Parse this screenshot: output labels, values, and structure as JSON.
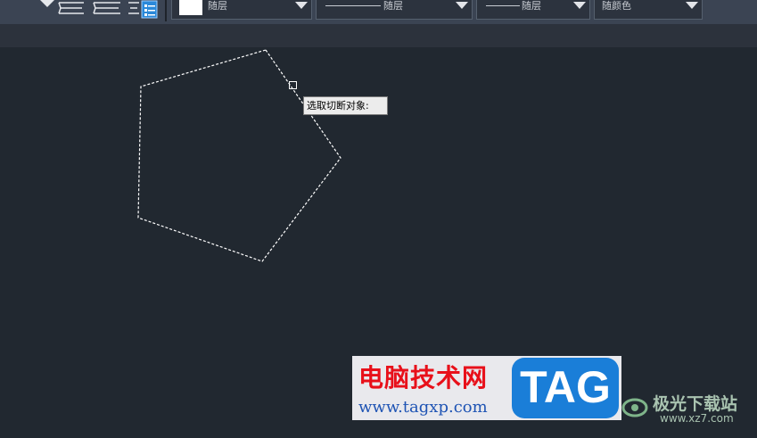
{
  "toolbar": {
    "layer_color": {
      "label": "随层",
      "swatch": "#ffffff"
    },
    "linetype": {
      "label": "随层"
    },
    "lineweight": {
      "label": "随层"
    },
    "plot_style": {
      "label": "随颜色"
    }
  },
  "canvas": {
    "tooltip": "选取切断对象:"
  },
  "watermark": {
    "site_name": "电脑技术网",
    "site_url": "www.tagxp.com",
    "tag": "TAG",
    "brand": "极光下载站",
    "brand_url": "www.xz7.com"
  }
}
